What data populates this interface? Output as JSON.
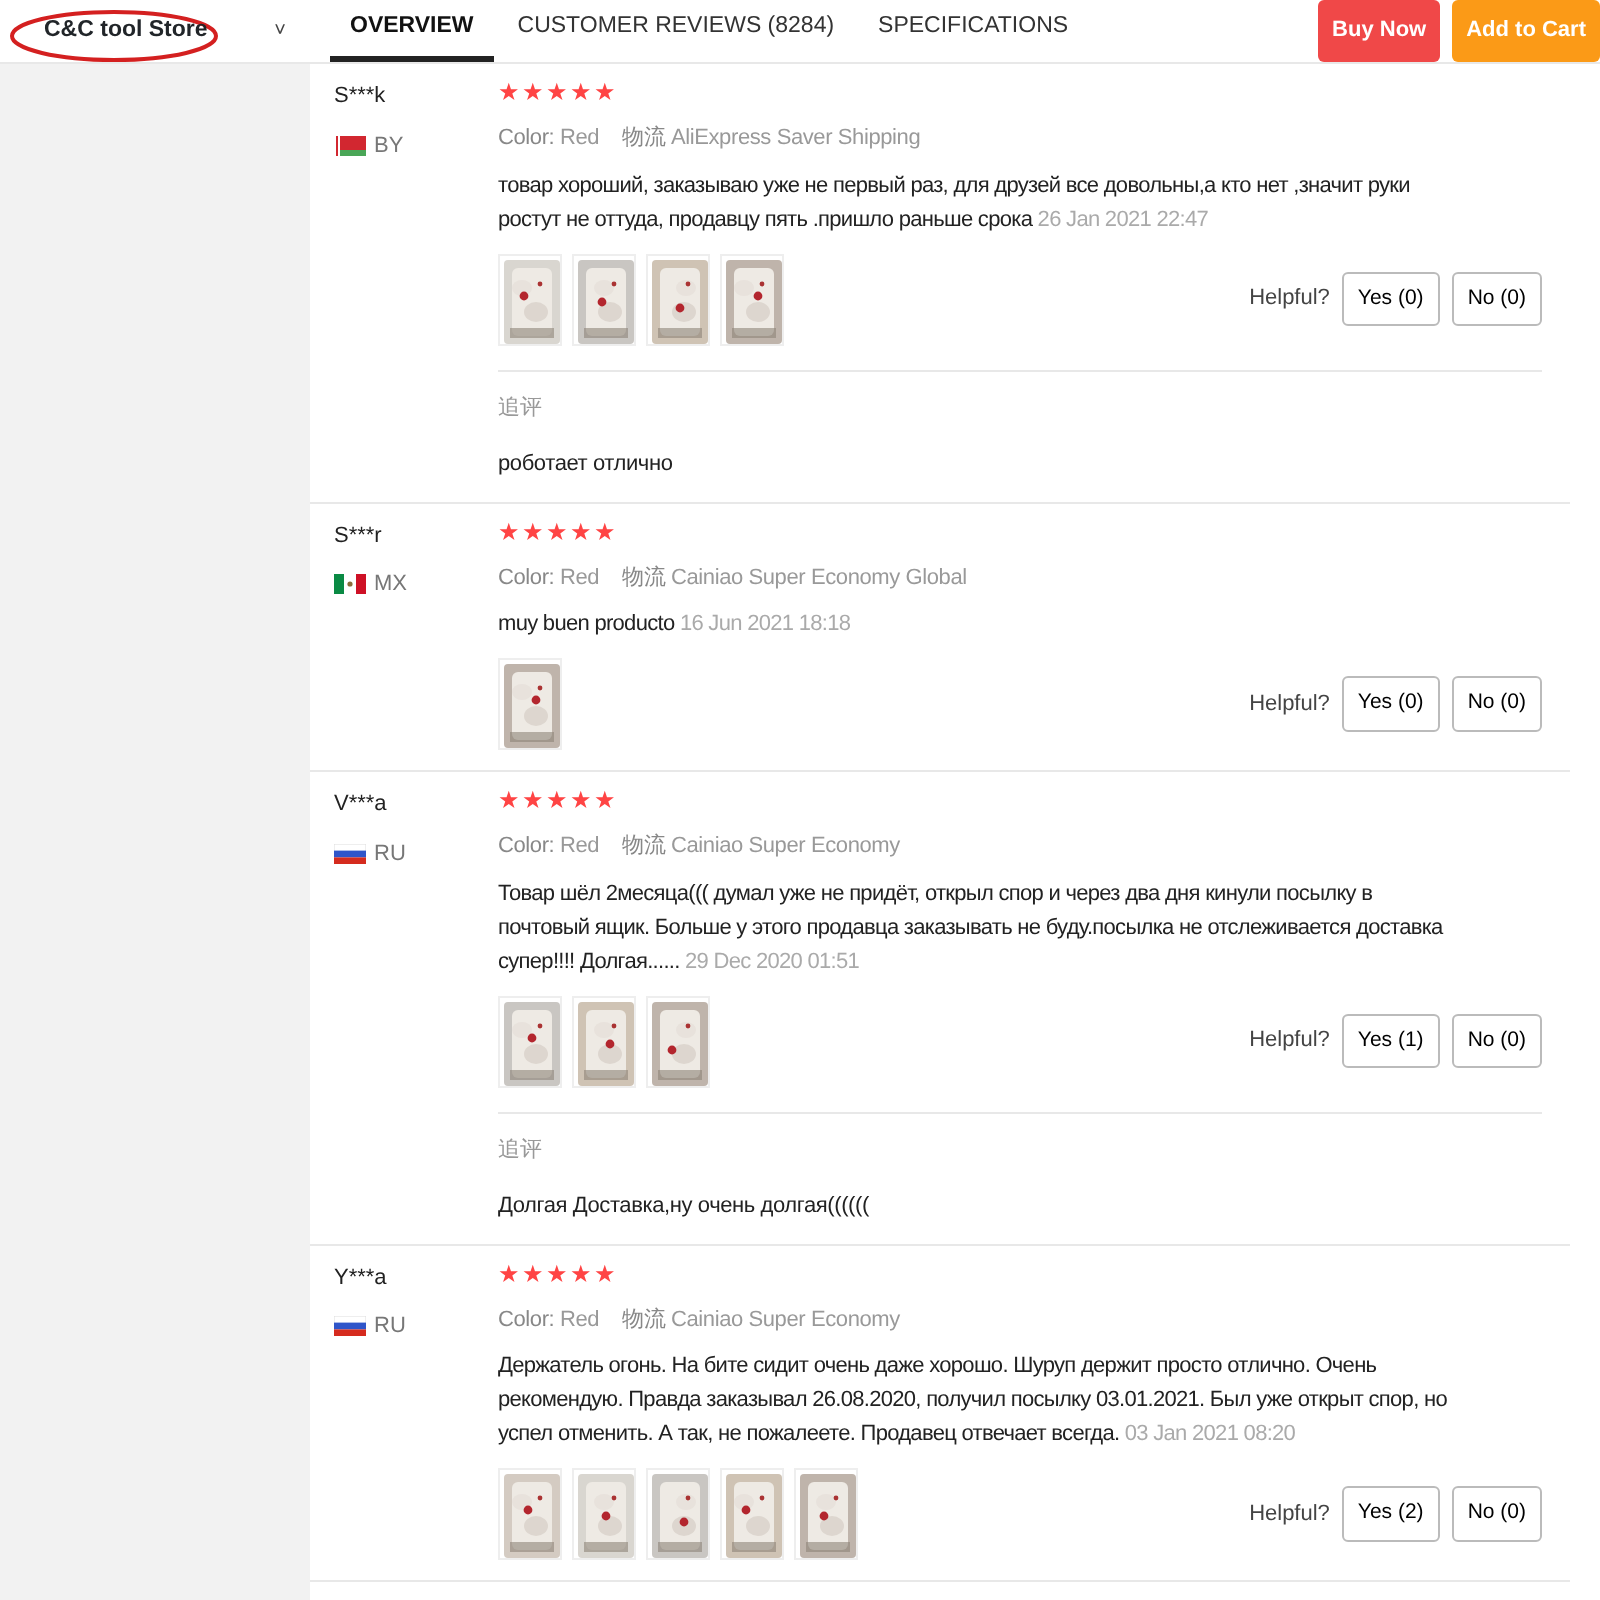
{
  "store": {
    "name": "C&C tool Store",
    "chevron": "˅",
    "circled": true
  },
  "tabs": [
    {
      "label": "OVERVIEW",
      "selected": true
    },
    {
      "label": "CUSTOMER REVIEWS (8284)",
      "selected": false
    },
    {
      "label": "SPECIFICATIONS",
      "selected": false
    }
  ],
  "actions": [
    {
      "label": "Buy Now",
      "kind": "buy"
    },
    {
      "label": "Add to Cart",
      "kind": "cart"
    }
  ],
  "reviews": [
    {
      "name": "S***k",
      "country": "BY",
      "flag": {
        "kind": "by"
      },
      "stars": 5,
      "color_label": "Color:",
      "color_value": "Red",
      "logistics_label": "物流",
      "shipping": "AliExpress Saver Shipping",
      "text": "товар хороший, заказываю уже не первый раз, для друзей все довольны,а кто нет ,значит руки ростут не оттуда, продавцу пять .пришло раньше срока",
      "date": "26 Jan 2021 22:47",
      "photos": [
        {
          "kind": "picture"
        },
        {
          "kind": "picture"
        },
        {
          "kind": "picture"
        },
        {
          "kind": "picture"
        }
      ],
      "helpful_label": "Helpful?",
      "yes": "Yes (0)",
      "no": "No (0)",
      "followup": {
        "label": "追评",
        "text": "роботает отлично"
      }
    },
    {
      "name": "S***r",
      "country": "MX",
      "flag": {
        "kind": "mx"
      },
      "stars": 5,
      "color_label": "Color:",
      "color_value": "Red",
      "logistics_label": "物流",
      "shipping": "Cainiao Super Economy Global",
      "text": "muy buen producto",
      "date": "16 Jun 2021 18:18",
      "photos": [
        {
          "kind": "picture"
        }
      ],
      "helpful_label": "Helpful?",
      "yes": "Yes (0)",
      "no": "No (0)"
    },
    {
      "name": "V***a",
      "country": "RU",
      "flag": {
        "kind": "ru"
      },
      "stars": 5,
      "color_label": "Color:",
      "color_value": "Red",
      "logistics_label": "物流",
      "shipping": "Cainiao Super Economy",
      "text": "Товар шёл 2месяца((( думал уже не придёт, открыл спор и через два дня кинули посылку в почтовый ящик. Больше у этого продавца заказывать не буду.посылка не отслеживается доставка супер!!!! Долгая......",
      "date": "29 Dec 2020 01:51",
      "photos": [
        {
          "kind": "picture"
        },
        {
          "kind": "picture"
        },
        {
          "kind": "picture"
        }
      ],
      "helpful_label": "Helpful?",
      "yes": "Yes (1)",
      "no": "No (0)",
      "followup": {
        "label": "追评",
        "text": "Долгая Доставка,ну очень долгая(((((("
      }
    },
    {
      "name": "Y***a",
      "country": "RU",
      "flag": {
        "kind": "ru"
      },
      "stars": 5,
      "color_label": "Color:",
      "color_value": "Red",
      "logistics_label": "物流",
      "shipping": "Cainiao Super Economy",
      "text": "Держатель огонь. На бите сидит очень даже хорошо. Шуруп держит просто отлично. Очень рекомендую. Правда заказывал 26.08.2020, получил посылку 03.01.2021. Был уже открыт спор, но успел отменить. А так, не пожалеете. Продавец отвечает всегда.",
      "date": "03 Jan 2021 08:20",
      "photos": [
        {
          "kind": "picture"
        },
        {
          "kind": "picture"
        },
        {
          "kind": "picture"
        },
        {
          "kind": "picture"
        },
        {
          "kind": "picture"
        }
      ],
      "helpful_label": "Helpful?",
      "yes": "Yes (2)",
      "no": "No (0)"
    }
  ]
}
